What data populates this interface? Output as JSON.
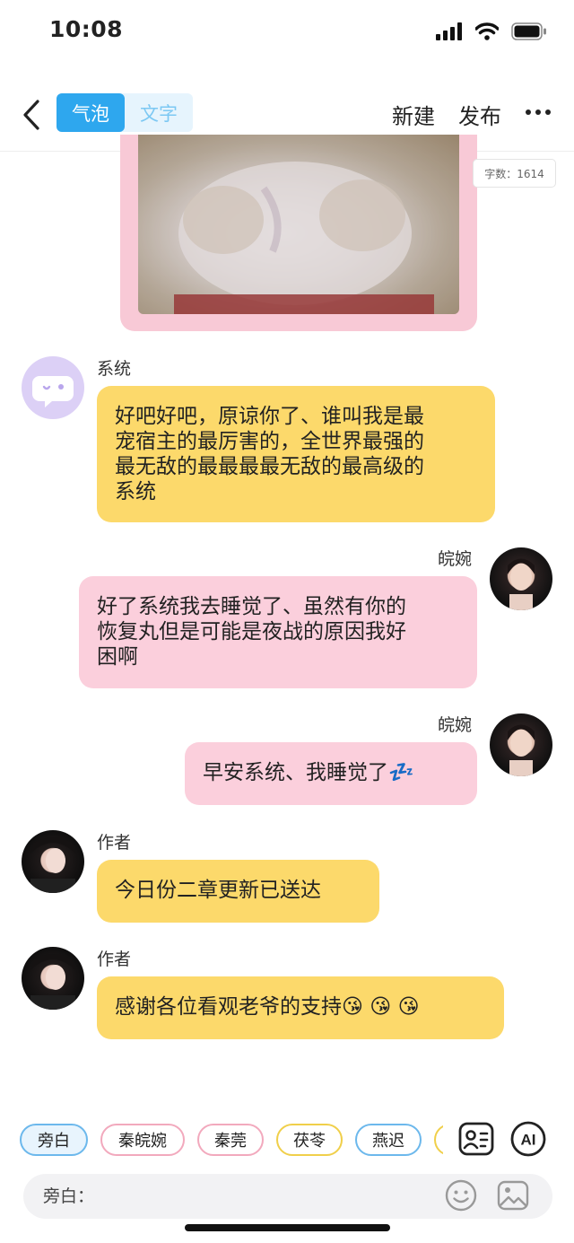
{
  "status": {
    "time": "10:08"
  },
  "header": {
    "tabs": [
      {
        "label": "气泡",
        "active": true
      },
      {
        "label": "文字",
        "active": false
      }
    ],
    "new_label": "新建",
    "publish_label": "发布"
  },
  "word_count": "字数：1614",
  "messages": [
    {
      "speaker": "系统",
      "text_lines": [
        "好吧好吧，原谅你了、谁叫我是最",
        "宠宿主的最厉害的，全世界最强的",
        "最无敌的最最最最无敌的最高级的",
        "系统"
      ]
    },
    {
      "speaker": "皖婉",
      "text_lines": [
        "好了系统我去睡觉了、虽然有你的",
        "恢复丸但是可能是夜战的原因我好",
        "困啊"
      ]
    },
    {
      "speaker": "皖婉",
      "text": "早安系统、我睡觉了",
      "emoji": "💤"
    },
    {
      "speaker": "作者",
      "text": "今日份二章更新已送达"
    },
    {
      "speaker": "作者",
      "text": "感谢各位看观老爷的支持",
      "emoji": "😘 😘 😘"
    }
  ],
  "chips": [
    "旁白",
    "秦皖婉",
    "秦莞",
    "茯苓",
    "燕迟"
  ],
  "input": {
    "label": "旁白："
  },
  "colors": {
    "accent": "#2ea7ee",
    "yellow_bubble": "#fcd96b",
    "pink_bubble": "#fbcfdc",
    "pink_frame": "#f8c9d6"
  }
}
